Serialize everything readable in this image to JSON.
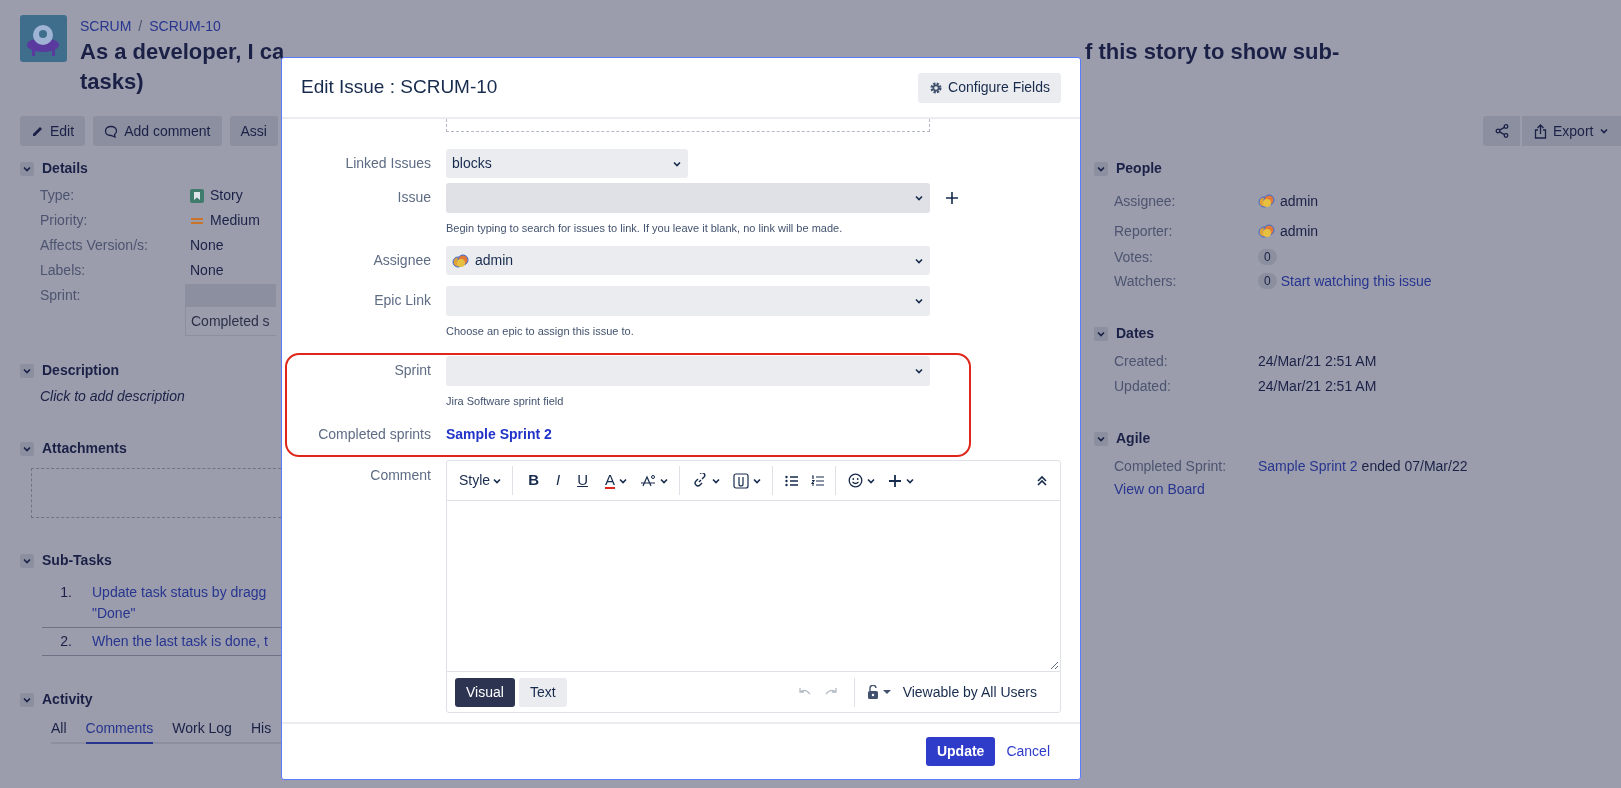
{
  "breadcrumbs": [
    {
      "label": "SCRUM"
    },
    {
      "label": "SCRUM-10"
    }
  ],
  "breadcrumb_separator": "/",
  "issue_title_fragments": [
    "As a developer, I ca",
    "f this story to show sub-",
    "tasks)"
  ],
  "actions": [
    {
      "label": "Edit",
      "kind": "edit"
    },
    {
      "label": "Add comment",
      "kind": "comment"
    },
    {
      "label": "Assi",
      "kind": "plain"
    }
  ],
  "export_button": "Export",
  "details": {
    "title": "Details",
    "rows": [
      {
        "label": "Type:",
        "value": "Story",
        "kind": "story"
      },
      {
        "label": "Priority:",
        "value": "Medium",
        "kind": "priority"
      },
      {
        "label": "Affects Version/s:",
        "value": "None",
        "kind": "text"
      },
      {
        "label": "Labels:",
        "value": "None",
        "kind": "text"
      },
      {
        "label": "Sprint:",
        "value": "Completed s",
        "kind": "sprint"
      }
    ]
  },
  "description": {
    "title": "Description",
    "prompt": "Click to add description"
  },
  "attachments": {
    "title": "Attachments"
  },
  "sub_tasks": {
    "title": "Sub-Tasks",
    "items": [
      {
        "number": "1.",
        "lines": [
          "Update task status by dragg",
          "\"Done\""
        ]
      },
      {
        "number": "2.",
        "lines": [
          "When the last task is done, t"
        ]
      }
    ]
  },
  "activity": {
    "title": "Activity",
    "tabs": [
      {
        "label": "All",
        "selected": false
      },
      {
        "label": "Comments",
        "selected": true
      },
      {
        "label": "Work Log",
        "selected": false
      },
      {
        "label": "His",
        "selected": false
      }
    ]
  },
  "people": {
    "title": "People",
    "rows": [
      {
        "label": "Assignee:",
        "kind": "user",
        "value": "admin"
      },
      {
        "label": "Reporter:",
        "kind": "user",
        "value": "admin"
      },
      {
        "label": "Votes:",
        "kind": "count",
        "count": "0"
      },
      {
        "label": "Watchers:",
        "kind": "count",
        "count": "0",
        "link": "Start watching this issue"
      }
    ]
  },
  "dates": {
    "title": "Dates",
    "rows": [
      {
        "label": "Created:",
        "value": "24/Mar/21 2:51 AM"
      },
      {
        "label": "Updated:",
        "value": "24/Mar/21 2:51 AM"
      }
    ]
  },
  "agile": {
    "title": "Agile",
    "rows": [
      {
        "label": "Completed Sprint:",
        "link": "Sample Sprint 2",
        "value": "ended 07/Mar/22"
      }
    ],
    "board_link": "View on Board"
  },
  "dialog": {
    "title": "Edit Issue : SCRUM-10",
    "configure_button": "Configure Fields",
    "fields": [
      {
        "kind": "short_select",
        "label": "Linked Issues",
        "value": "blocks",
        "highlighted": false
      },
      {
        "kind": "issue_select",
        "label": "Issue",
        "help": "Begin typing to search for issues to link. If you leave it blank, no link will be made.",
        "highlighted": false
      },
      {
        "kind": "user_select",
        "label": "Assignee",
        "value": "admin",
        "highlighted": false
      },
      {
        "kind": "select",
        "label": "Epic Link",
        "help": "Choose an epic to assign this issue to.",
        "highlighted": false
      },
      {
        "kind": "select",
        "label": "Sprint",
        "help": "Jira Software sprint field",
        "highlighted": true
      },
      {
        "kind": "link",
        "label": "Completed sprints",
        "value": "Sample Sprint 2",
        "highlighted": true
      }
    ],
    "comment": {
      "label": "Comment",
      "style_menu": "Style",
      "format_buttons": [
        "B",
        "I",
        "U",
        "A"
      ],
      "modes": [
        {
          "label": "Visual",
          "selected": true
        },
        {
          "label": "Text",
          "selected": false
        }
      ],
      "visibility": "Viewable by All Users"
    },
    "update_button": "Update",
    "cancel_link": "Cancel"
  }
}
